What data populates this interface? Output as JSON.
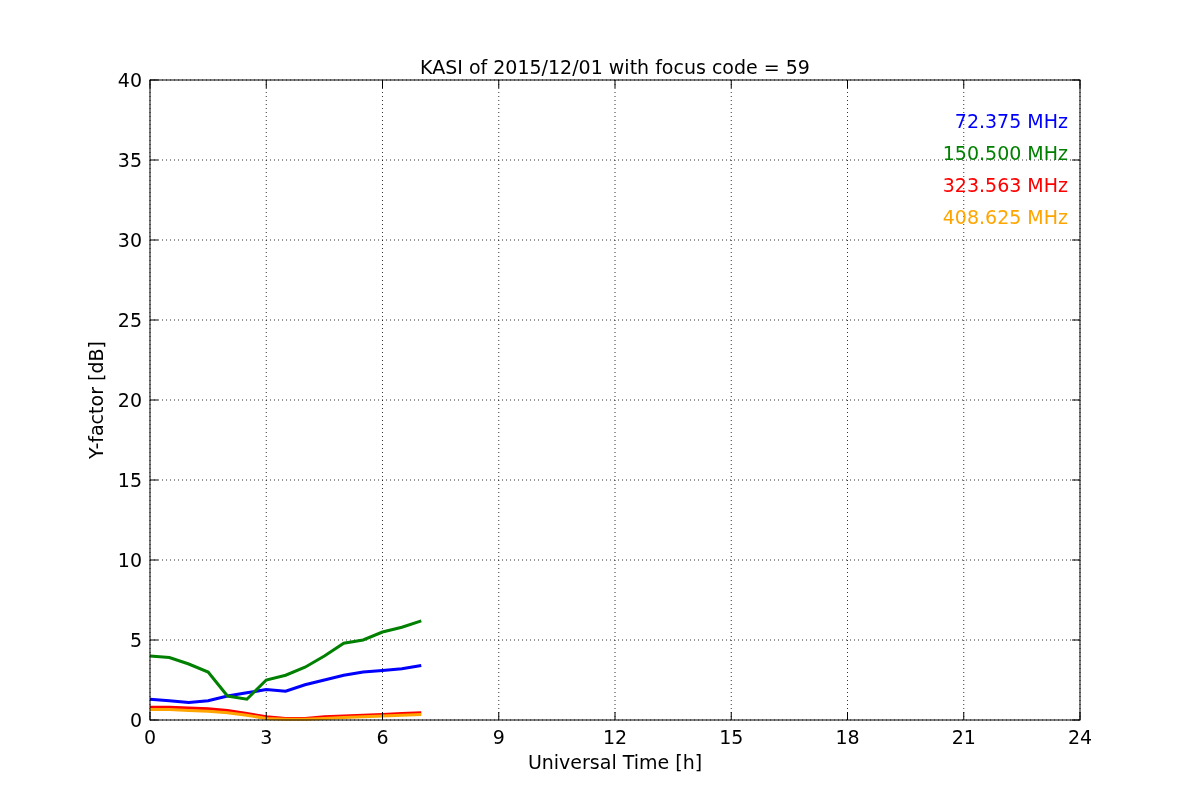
{
  "chart_data": {
    "type": "line",
    "title": "KASI of 2015/12/01 with focus code = 59",
    "xlabel": "Universal Time [h]",
    "ylabel": "Y-factor [dB]",
    "x": [
      0,
      0.5,
      1,
      1.5,
      2,
      2.5,
      3,
      3.5,
      4,
      4.5,
      5,
      5.5,
      6,
      6.5,
      7
    ],
    "series": [
      {
        "name": "72.375 MHz",
        "color": "#0000ff",
        "values": [
          1.3,
          1.2,
          1.1,
          1.2,
          1.5,
          1.7,
          1.9,
          1.8,
          2.2,
          2.5,
          2.8,
          3.0,
          3.1,
          3.2,
          3.4
        ]
      },
      {
        "name": "150.500 MHz",
        "color": "#008000",
        "values": [
          4.0,
          3.9,
          3.5,
          3.0,
          1.5,
          1.3,
          2.5,
          2.8,
          3.3,
          4.0,
          4.8,
          5.0,
          5.5,
          5.8,
          6.2
        ]
      },
      {
        "name": "323.563 MHz",
        "color": "#ff0000",
        "values": [
          0.8,
          0.8,
          0.75,
          0.7,
          0.6,
          0.4,
          0.2,
          0.1,
          0.1,
          0.2,
          0.25,
          0.3,
          0.35,
          0.4,
          0.45
        ]
      },
      {
        "name": "408.625 MHz",
        "color": "#ffa500",
        "values": [
          0.65,
          0.65,
          0.6,
          0.55,
          0.45,
          0.3,
          0.1,
          0.05,
          0.05,
          0.1,
          0.15,
          0.2,
          0.25,
          0.3,
          0.35
        ]
      }
    ],
    "xlim": [
      0,
      24
    ],
    "ylim": [
      0,
      40
    ],
    "xticks": [
      0,
      3,
      6,
      9,
      12,
      15,
      18,
      21,
      24
    ],
    "yticks": [
      0,
      5,
      10,
      15,
      20,
      25,
      30,
      35,
      40
    ],
    "grid": true
  }
}
